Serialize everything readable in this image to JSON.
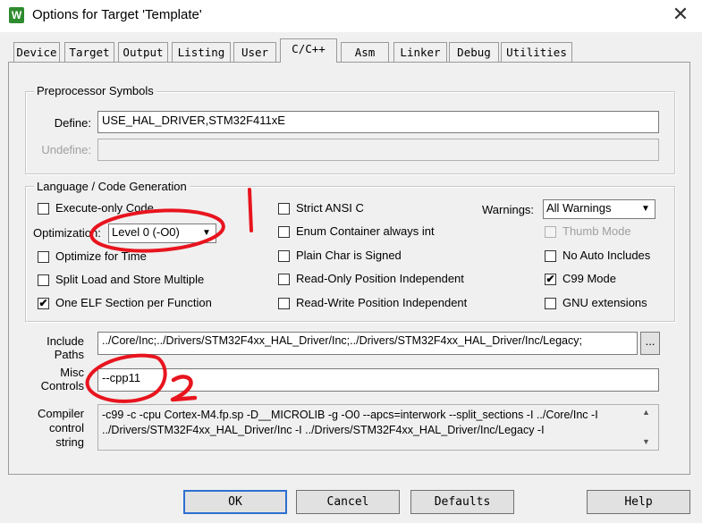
{
  "window": {
    "title": "Options for Target 'Template'",
    "close_glyph": "✕",
    "icon_letter": "W"
  },
  "tabs": [
    {
      "label": "Device"
    },
    {
      "label": "Target"
    },
    {
      "label": "Output"
    },
    {
      "label": "Listing"
    },
    {
      "label": "User"
    },
    {
      "label": "C/C++",
      "active": true
    },
    {
      "label": "Asm"
    },
    {
      "label": "Linker"
    },
    {
      "label": "Debug"
    },
    {
      "label": "Utilities"
    }
  ],
  "preprocessor": {
    "legend": "Preprocessor Symbols",
    "define_label": "Define:",
    "define_value": "USE_HAL_DRIVER,STM32F411xE",
    "undefine_label": "Undefine:",
    "undefine_value": ""
  },
  "codegen": {
    "legend": "Language / Code Generation",
    "execute_only": {
      "label": "Execute-only Code",
      "checked": false
    },
    "optimization_label": "Optimization:",
    "optimization_value": "Level 0 (-O0)",
    "optimize_time": {
      "label": "Optimize for Time",
      "checked": false
    },
    "split_load": {
      "label": "Split Load and Store Multiple",
      "checked": false
    },
    "one_elf": {
      "label": "One ELF Section per Function",
      "checked": true
    },
    "strict_ansi": {
      "label": "Strict ANSI C",
      "checked": false
    },
    "enum_container": {
      "label": "Enum Container always int",
      "checked": false
    },
    "plain_char": {
      "label": "Plain Char is Signed",
      "checked": false
    },
    "ro_pi": {
      "label": "Read-Only Position Independent",
      "checked": false
    },
    "rw_pi": {
      "label": "Read-Write Position Independent",
      "checked": false
    },
    "warnings_label": "Warnings:",
    "warnings_value": "All Warnings",
    "thumb_mode": {
      "label": "Thumb Mode",
      "checked": false,
      "disabled": true
    },
    "no_auto_includes": {
      "label": "No Auto Includes",
      "checked": false
    },
    "c99_mode": {
      "label": "C99 Mode",
      "checked": true
    },
    "gnu_ext": {
      "label": "GNU extensions",
      "checked": false
    }
  },
  "include": {
    "label_line1": "Include",
    "label_line2": "Paths",
    "value": "../Core/Inc;../Drivers/STM32F4xx_HAL_Driver/Inc;../Drivers/STM32F4xx_HAL_Driver/Inc/Legacy;",
    "browse": "..."
  },
  "misc": {
    "label_line1": "Misc",
    "label_line2": "Controls",
    "value": "--cpp11"
  },
  "compiler": {
    "label_line1": "Compiler",
    "label_line2": "control",
    "label_line3": "string",
    "line1": "-c99 -c -cpu Cortex-M4.fp.sp -D__MICROLIB -g -O0 --apcs=interwork --split_sections -I ../Core/Inc -I",
    "line2": "../Drivers/STM32F4xx_HAL_Driver/Inc -I ../Drivers/STM32F4xx_HAL_Driver/Inc/Legacy -I"
  },
  "buttons": {
    "ok": "OK",
    "cancel": "Cancel",
    "defaults": "Defaults",
    "help": "Help"
  },
  "annotations": {
    "mark1": "1",
    "mark2": "2",
    "ink_color": "#e8141e"
  },
  "check_glyph": "✔",
  "arrow_glyph": "▼",
  "scroll_up": "▲",
  "scroll_down": "▼"
}
